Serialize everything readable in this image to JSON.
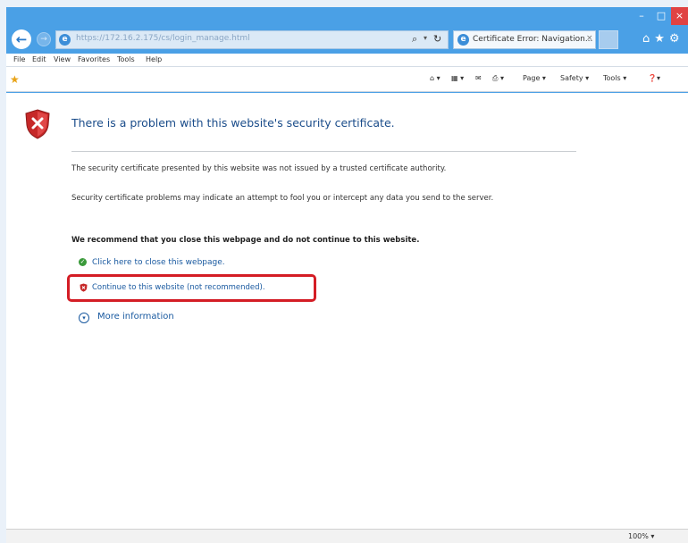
{
  "window": {
    "min": "–",
    "max": "□",
    "close": "×"
  },
  "nav": {
    "back": "←",
    "forward": "→",
    "url": "https://172.16.2.175/cs/login_manage.html",
    "search_icon": "⌕",
    "dropdown": "▾",
    "refresh": "↻",
    "ie_glyph": "e"
  },
  "tab": {
    "title": "Certificate Error: Navigation...",
    "close": "×"
  },
  "right_icons": "⌂★⚙",
  "menu": {
    "file": "File",
    "edit": "Edit",
    "view": "View",
    "favorites": "Favorites",
    "tools": "Tools",
    "help": "Help"
  },
  "commands": {
    "favorites_star": "★",
    "home": "⌂ ▾",
    "feeds": "▦ ▾",
    "mail": "✉",
    "print": "⎙ ▾",
    "page": "Page ▾",
    "safety": "Safety ▾",
    "tools": "Tools ▾",
    "help": "❓▾"
  },
  "content": {
    "heading": "There is a problem with this website's security certificate.",
    "p1": "The security certificate presented by this website was not issued by a trusted certificate authority.",
    "p2": "Security certificate problems may indicate an attempt to fool you or intercept any data you send to the server.",
    "recommend": "We recommend that you close this webpage and do not continue to this website.",
    "close_link": "Click here to close this webpage.",
    "continue_link": "Continue to this website (not recommended).",
    "more_info": "More information",
    "ok_glyph": "✓",
    "more_glyph": "▾"
  },
  "status": {
    "zoom": "100%  ▾"
  },
  "colors": {
    "frame": "#4aa0e6",
    "heading": "#1a4c8a",
    "link": "#1a5aa0",
    "highlight": "#d41d25"
  }
}
